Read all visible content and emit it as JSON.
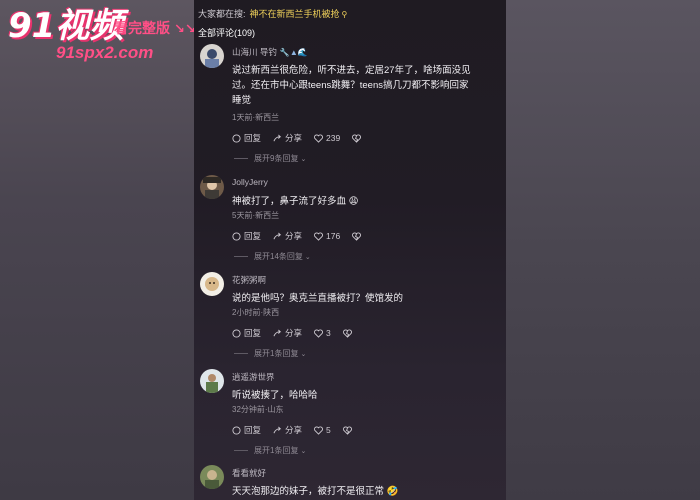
{
  "watermark": {
    "logo": "91视频",
    "cta": "看完整版",
    "arrows": "↘↘",
    "url": "91spx2.com"
  },
  "search": {
    "label": "大家都在搜:",
    "keyword": "神不在新西兰手机被抢"
  },
  "comments_header": "全部评论(109)",
  "comments": [
    {
      "user": "山海川 导钓",
      "badge": "🔧▲🌊",
      "text": "说过新西兰很危险，听不进去，定居27年了，啥场面没见过。还在市中心跟teens跳舞？teens搞几刀都不影响回家睡觉",
      "meta": "1天前·新西兰",
      "reply": "回复",
      "share": "分享",
      "likes": "239",
      "expand": "展开9条回复"
    },
    {
      "user": "JollyJerry",
      "badge": "",
      "text": "神被打了，鼻子流了好多血 😩",
      "meta": "5天前·新西兰",
      "reply": "回复",
      "share": "分享",
      "likes": "176",
      "expand": "展开14条回复"
    },
    {
      "user": "花粥粥啊",
      "badge": "",
      "text": "说的是他吗？奥克兰直播被打？使馆发的",
      "meta": "2小时前·陕西",
      "reply": "回复",
      "share": "分享",
      "likes": "3",
      "expand": "展开1条回复"
    },
    {
      "user": "逍遥游世界",
      "badge": "",
      "text": "听说被揍了，哈哈哈",
      "meta": "32分钟前·山东",
      "reply": "回复",
      "share": "分享",
      "likes": "5",
      "expand": "展开1条回复"
    },
    {
      "user": "看看就好",
      "badge": "",
      "text": "天天泡那边的妹子，被打不是很正常 🤣",
      "meta": "",
      "reply": "",
      "share": "",
      "likes": "",
      "expand": ""
    }
  ],
  "colors": {
    "accent_pink": "#ff4f86",
    "keyword_yellow": "#f2d35b"
  }
}
